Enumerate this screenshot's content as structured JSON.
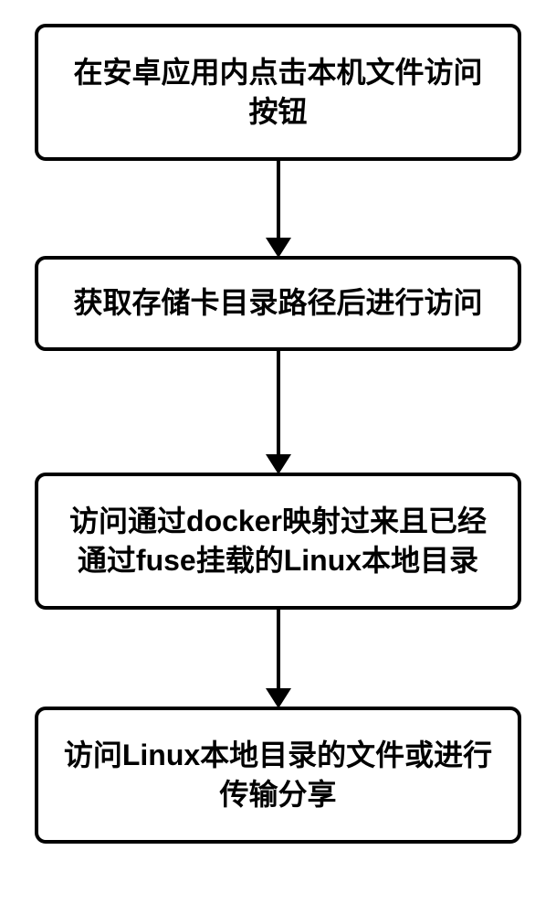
{
  "chart_data": {
    "type": "flowchart",
    "direction": "top-to-bottom",
    "nodes": [
      {
        "id": "n1",
        "text": "在安卓应用内点击本机文件访问按钮"
      },
      {
        "id": "n2",
        "text": "获取存储卡目录路径后进行访问"
      },
      {
        "id": "n3",
        "text": "访问通过docker映射过来且已经通过fuse挂载的Linux本地目录"
      },
      {
        "id": "n4",
        "text": "访问Linux本地目录的文件或进行传输分享"
      }
    ],
    "edges": [
      {
        "from": "n1",
        "to": "n2"
      },
      {
        "from": "n2",
        "to": "n3"
      },
      {
        "from": "n3",
        "to": "n4"
      }
    ]
  }
}
